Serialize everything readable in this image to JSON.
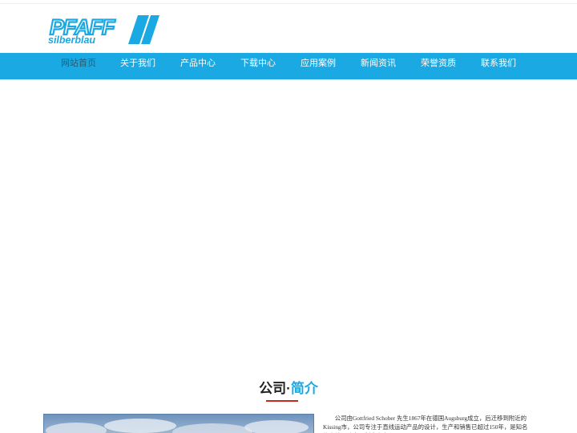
{
  "header": {
    "logo_primary": "PFAFF",
    "logo_secondary": "silberblau",
    "logo_color": "#1aa9e3"
  },
  "nav": {
    "items": [
      {
        "label": "网站首页",
        "active": true
      },
      {
        "label": "关于我们"
      },
      {
        "label": "产品中心"
      },
      {
        "label": "下载中心"
      },
      {
        "label": "应用案例"
      },
      {
        "label": "新闻资讯"
      },
      {
        "label": "荣誉资质"
      },
      {
        "label": "联系我们"
      }
    ],
    "bg_color": "#1aa9e3"
  },
  "intro": {
    "title_left": "公司·",
    "title_right": "简介",
    "text": "公司由Gottfried Schober 先生1867年在德国Augsburg成立，后迁移到附近的Kissing市，公司专注于直线运动产品的设计，生产和销售已超过150年，是知名的直线运动产品制造商之一",
    "accent_color": "#c8281e"
  }
}
